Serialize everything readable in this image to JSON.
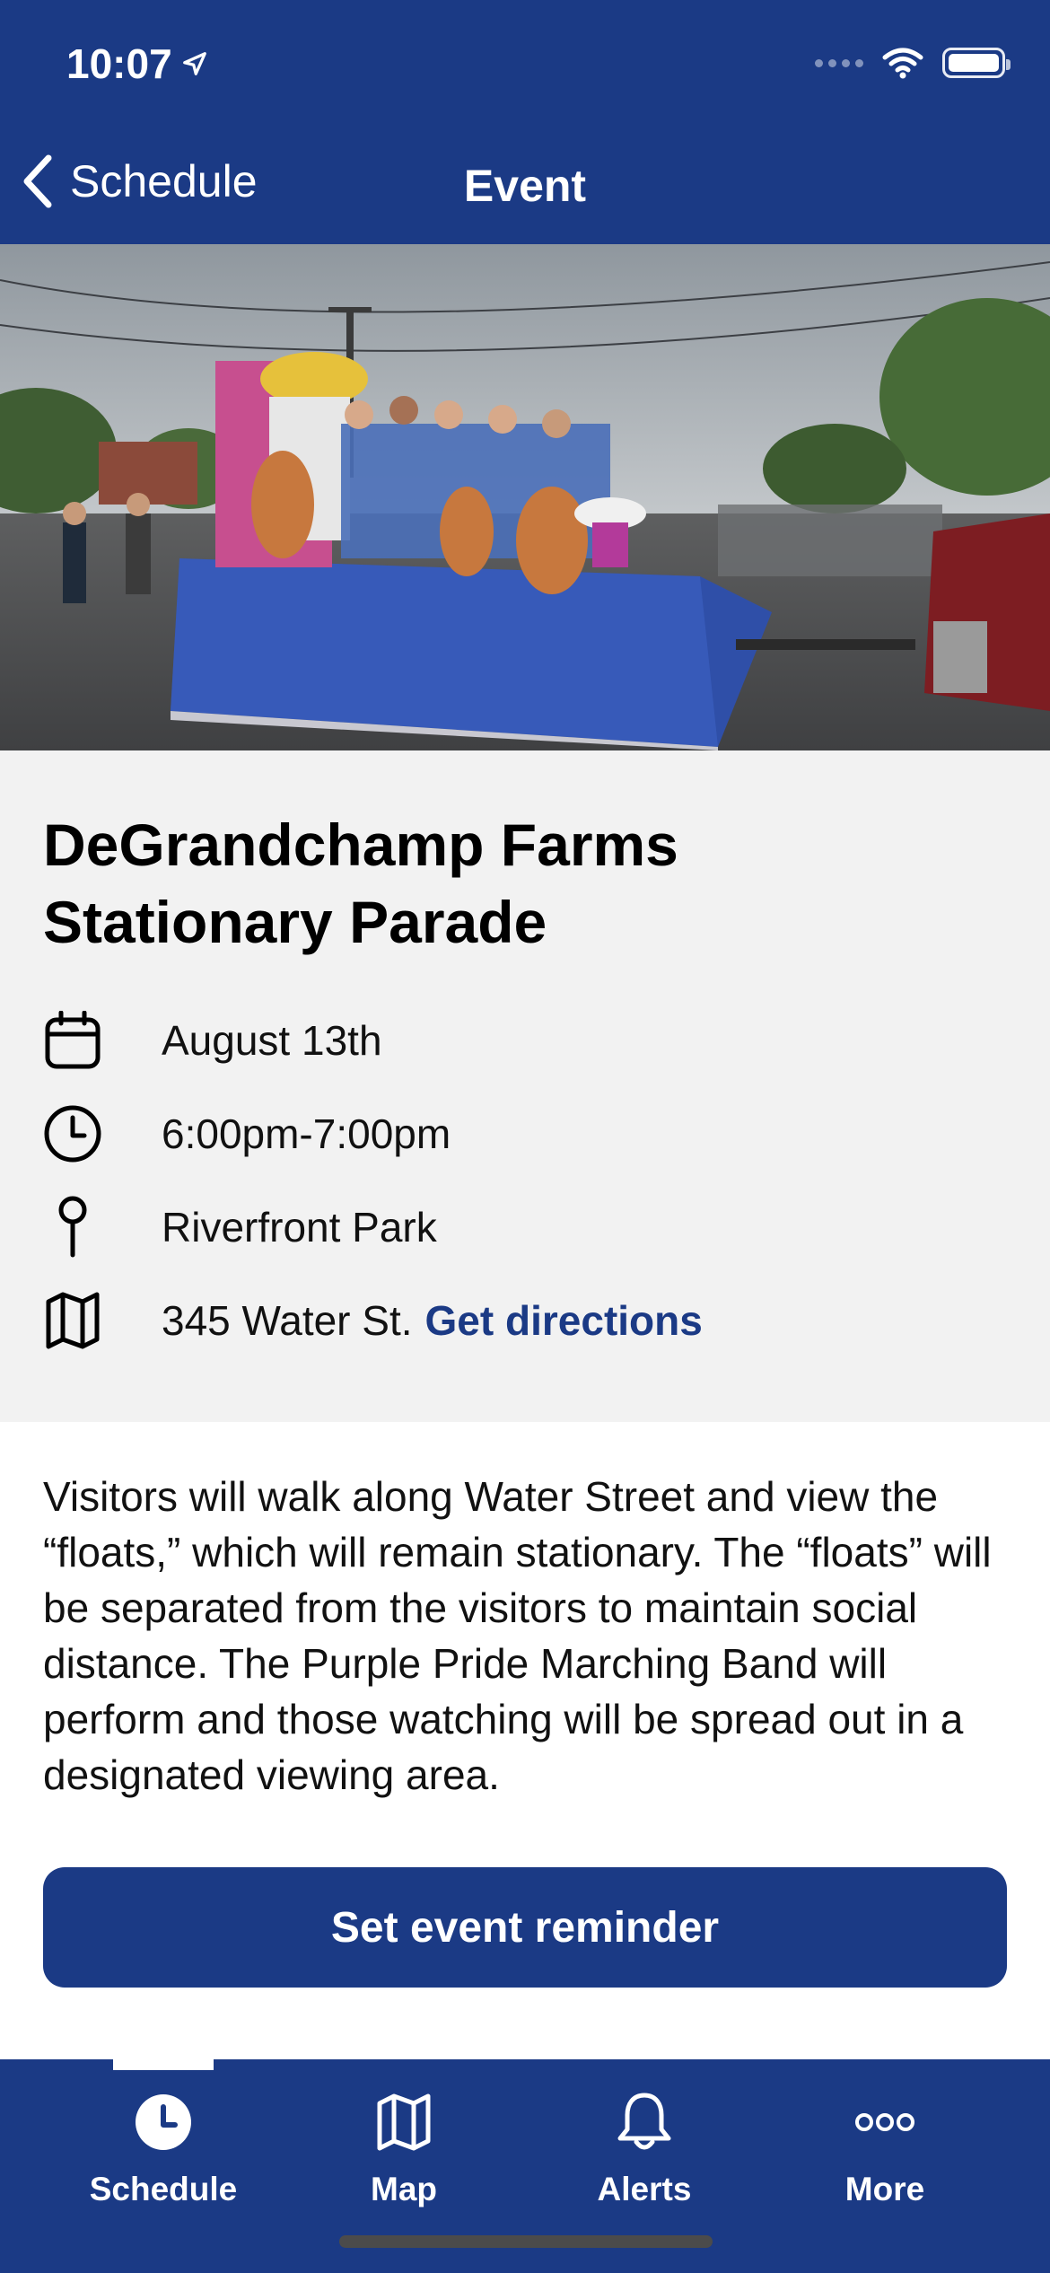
{
  "status_bar": {
    "time": "10:07"
  },
  "nav": {
    "back_label": "Schedule",
    "title": "Event"
  },
  "event": {
    "title": "DeGrandchamp Farms Stationary Parade",
    "date": "August 13th",
    "time": "6:00pm-7:00pm",
    "location": "Riverfront Park",
    "address": "345 Water St.",
    "directions_label": "Get directions",
    "description": "Visitors will walk along Water Street and view the “floats,” which will remain stationary. The “floats” will be separated from the visitors to maintain social distance. The Purple Pride Marching Band will perform and those watching will be spread out in a designated viewing area."
  },
  "reminder_button": {
    "label": "Set event reminder"
  },
  "tabs": [
    {
      "label": "Schedule",
      "icon": "clock-icon",
      "active": true
    },
    {
      "label": "Map",
      "icon": "map-icon",
      "active": false
    },
    {
      "label": "Alerts",
      "icon": "bell-icon",
      "active": false
    },
    {
      "label": "More",
      "icon": "more-icon",
      "active": false
    }
  ],
  "colors": {
    "brand": "#1b3a85",
    "info_bg": "#f2f2f2",
    "link": "#1b3a85"
  }
}
